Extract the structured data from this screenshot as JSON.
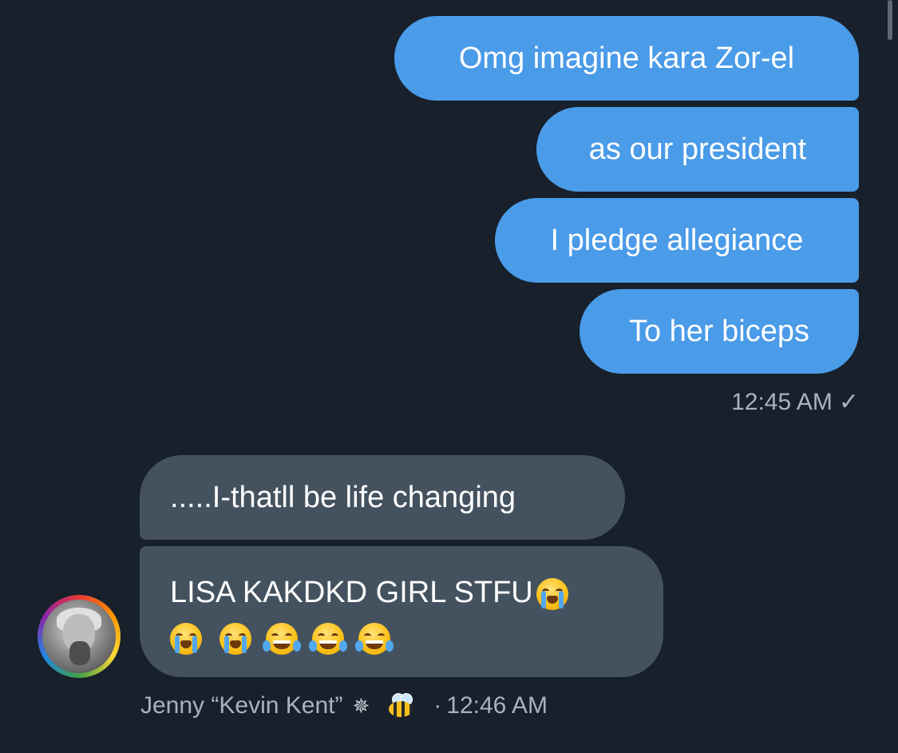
{
  "messages_outgoing": [
    {
      "text": "Omg imagine kara Zor-el"
    },
    {
      "text": "as our president"
    },
    {
      "text": "I pledge allegiance"
    },
    {
      "text": "To her biceps"
    }
  ],
  "outgoing_meta": {
    "time": "12:45 AM",
    "status_icon": "check-icon",
    "status_glyph": "✓"
  },
  "messages_incoming": [
    {
      "text": ".....I-thatll be life changing"
    },
    {
      "text_line1": "LISA KAKDKD GIRL STFU",
      "emojis": [
        "loudly-crying-face",
        "loudly-crying-face",
        "loudly-crying-face",
        "face-with-tears-of-joy",
        "face-with-tears-of-joy",
        "face-with-tears-of-joy"
      ]
    }
  ],
  "sender": {
    "name": "Jenny “Kevin Kent”",
    "sparkle_glyph": "✵",
    "badge_icon": "bee-icon",
    "separator": "·",
    "time": "12:46 AM",
    "avatar_icon": "avatar-photo"
  },
  "colors": {
    "background": "#17202b",
    "outgoing_bubble": "#4a9be8",
    "incoming_bubble": "#44525f",
    "meta_text": "#a9b3bd"
  }
}
